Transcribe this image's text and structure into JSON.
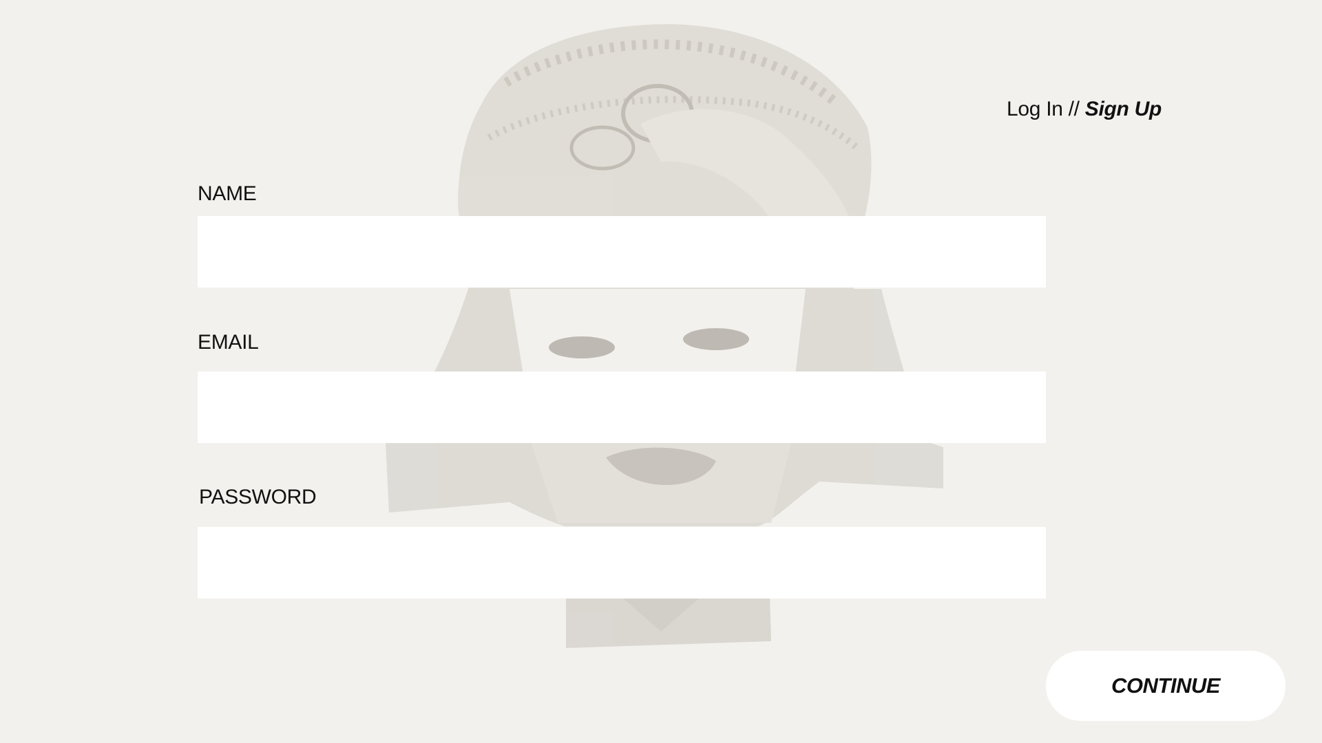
{
  "auth_switch": {
    "login_label": "Log In",
    "separator": " // ",
    "signup_label": "Sign Up"
  },
  "form": {
    "name_label": "NAME",
    "name_value": "",
    "email_label": "EMAIL",
    "email_value": "",
    "password_label": "PASSWORD",
    "password_value": ""
  },
  "continue_button": {
    "label": "CONTINUE"
  },
  "colors": {
    "background": "#f3f1ed",
    "input_fill": "#ffffff",
    "text": "#111111"
  }
}
